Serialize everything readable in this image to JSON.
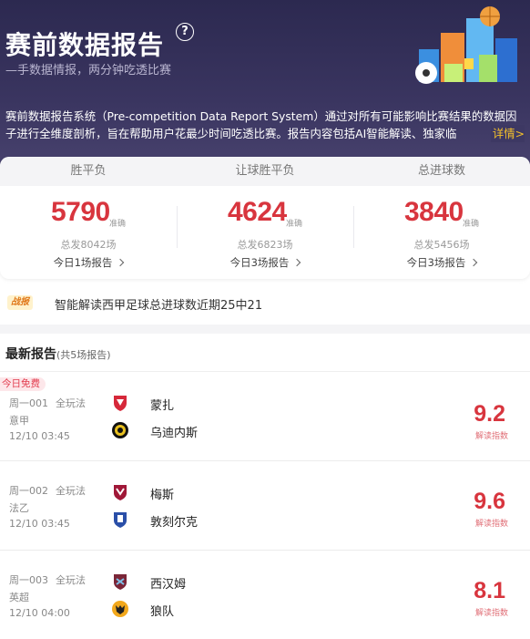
{
  "header": {
    "title": "赛前数据报告",
    "help_symbol": "?",
    "subtitle": "—手数据情报，两分钟吃透比赛",
    "description": "赛前数据报告系统（Pre-competition Data Report System）通过对所有可能影响比赛结果的数据因子进行全维度剖析，旨在帮助用户花最少时间吃透比赛。报告内容包括AI智能解读、独家临",
    "more_label": "详情>"
  },
  "stats": {
    "columns": [
      {
        "header": "胜平负",
        "value": "5790",
        "tag": "准确",
        "total": "总发8042场",
        "today": "今日1场报告"
      },
      {
        "header": "让球胜平负",
        "value": "4624",
        "tag": "准确",
        "total": "总发6823场",
        "today": "今日3场报告"
      },
      {
        "header": "总进球数",
        "value": "3840",
        "tag": "准确",
        "total": "总发5456场",
        "today": "今日3场报告"
      }
    ]
  },
  "ticker": {
    "badge": "战报",
    "text": "智能解读西甲足球总进球数近期25中21"
  },
  "section": {
    "title": "最新报告",
    "count": "(共5场报告)"
  },
  "matches": [
    {
      "free_tag": "今日免费",
      "code": "周一001",
      "play": "全玩法",
      "league": "意甲",
      "time": "12/10 03:45",
      "home": "蒙扎",
      "away": "乌迪内斯",
      "score": "9.2",
      "score_label": "解读指数"
    },
    {
      "free_tag": "",
      "code": "周一002",
      "play": "全玩法",
      "league": "法乙",
      "time": "12/10 03:45",
      "home": "梅斯",
      "away": "敦刻尔克",
      "score": "9.6",
      "score_label": "解读指数"
    },
    {
      "free_tag": "",
      "code": "周一003",
      "play": "全玩法",
      "league": "英超",
      "time": "12/10 04:00",
      "home": "西汉姆",
      "away": "狼队",
      "score": "8.1",
      "score_label": "解读指数"
    }
  ],
  "colors": {
    "accent_red": "#d8353e",
    "header_bg": "#2c2950",
    "link_yellow": "#f4c02b"
  }
}
